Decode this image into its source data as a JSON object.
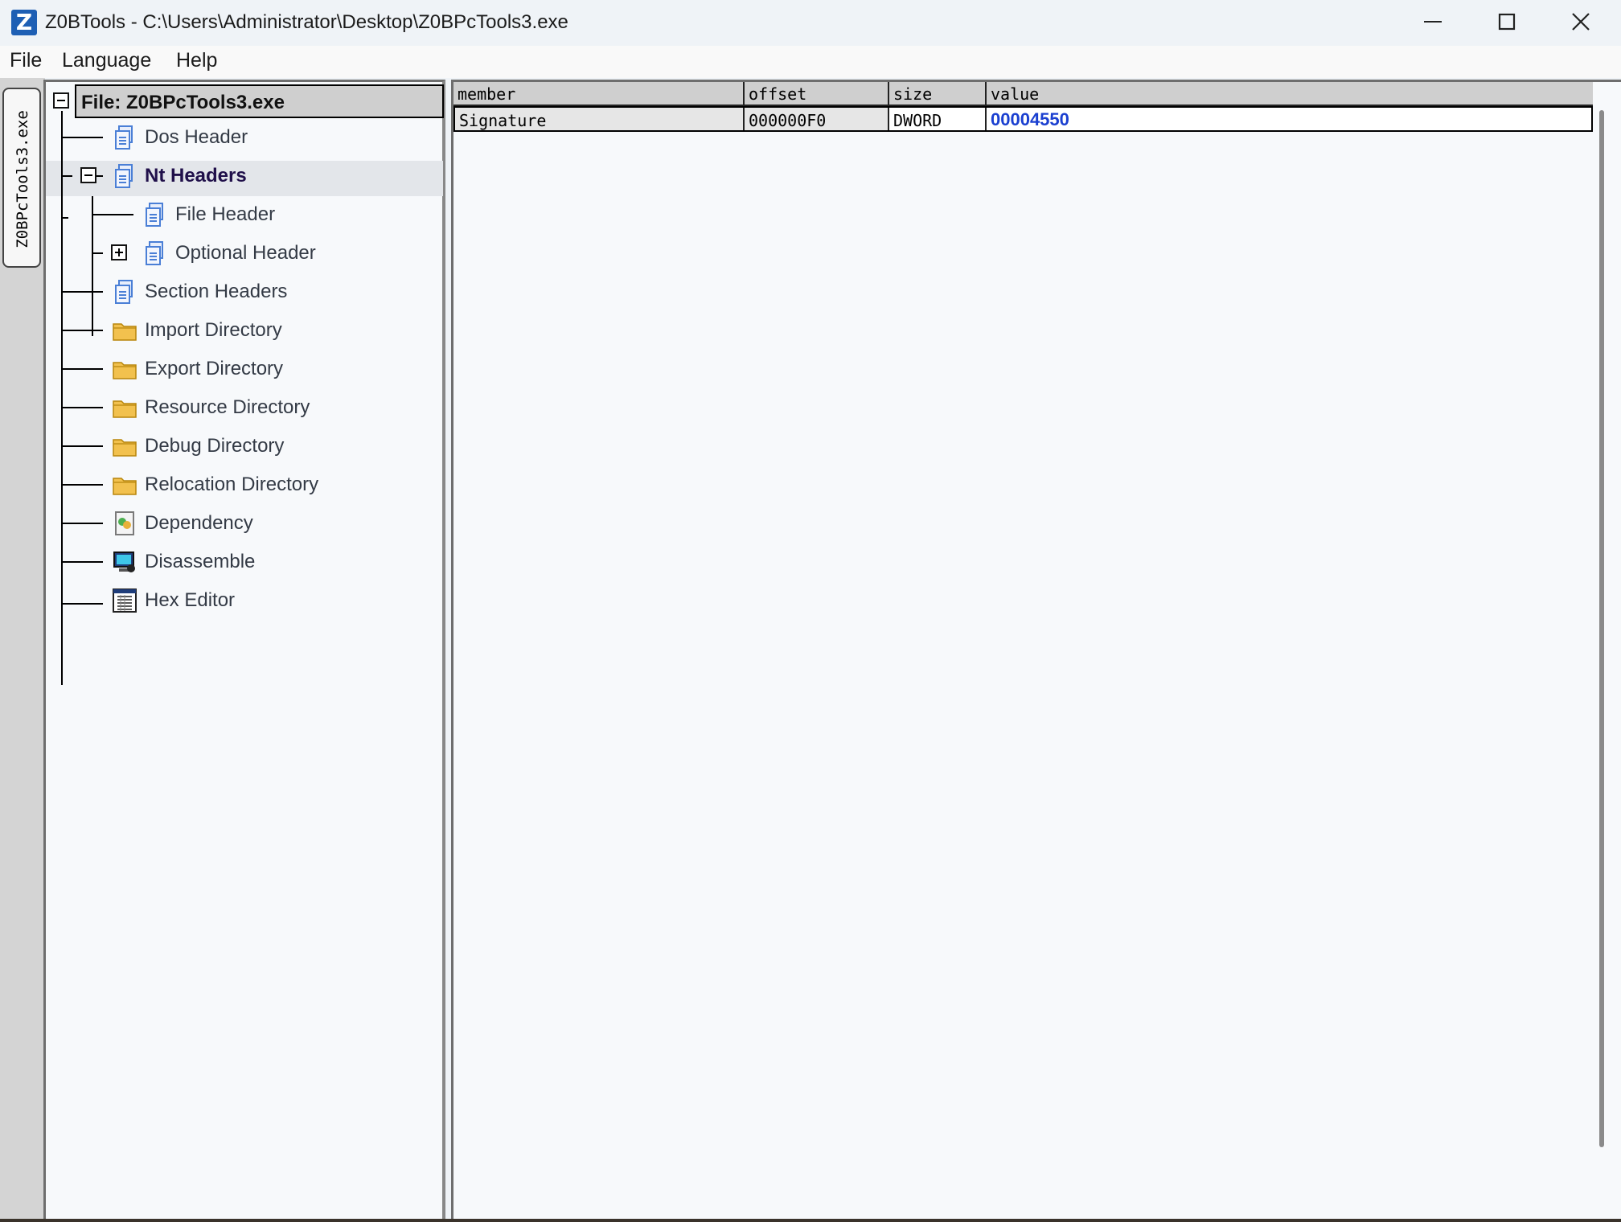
{
  "window": {
    "title": "Z0BTools - C:\\Users\\Administrator\\Desktop\\Z0BPcTools3.exe",
    "app_icon_letter": "Z"
  },
  "menu": [
    "File",
    "Language",
    "Help"
  ],
  "side_tab": {
    "label": "Z0BPcTools3.exe"
  },
  "tree": {
    "root": "File: Z0BPcTools3.exe",
    "nodes": [
      {
        "label": "Dos Header",
        "icon": "document-icon"
      },
      {
        "label": "Nt Headers",
        "icon": "document-icon",
        "selected": true,
        "expanded": true
      },
      {
        "label": "File Header",
        "icon": "document-icon"
      },
      {
        "label": "Optional Header",
        "icon": "document-icon",
        "expanded": false
      },
      {
        "label": "Section Headers",
        "icon": "document-icon"
      },
      {
        "label": "Import Directory",
        "icon": "folder-icon"
      },
      {
        "label": "Export Directory",
        "icon": "folder-icon"
      },
      {
        "label": "Resource Directory",
        "icon": "folder-icon"
      },
      {
        "label": "Debug Directory",
        "icon": "folder-icon"
      },
      {
        "label": "Relocation Directory",
        "icon": "folder-icon"
      },
      {
        "label": "Dependency",
        "icon": "dependency-icon"
      },
      {
        "label": "Disassemble",
        "icon": "disassemble-icon"
      },
      {
        "label": "Hex Editor",
        "icon": "hex-grid-icon"
      }
    ]
  },
  "table": {
    "columns": [
      "member",
      "offset",
      "size",
      "value"
    ],
    "rows": [
      [
        "Signature",
        "000000F0",
        "DWORD",
        "00004550"
      ]
    ]
  },
  "colors": {
    "value_text": "#1a3fd0",
    "selected_node_text": "#20104a",
    "folder": "#f2c14e",
    "document": "#4a7fd6"
  }
}
